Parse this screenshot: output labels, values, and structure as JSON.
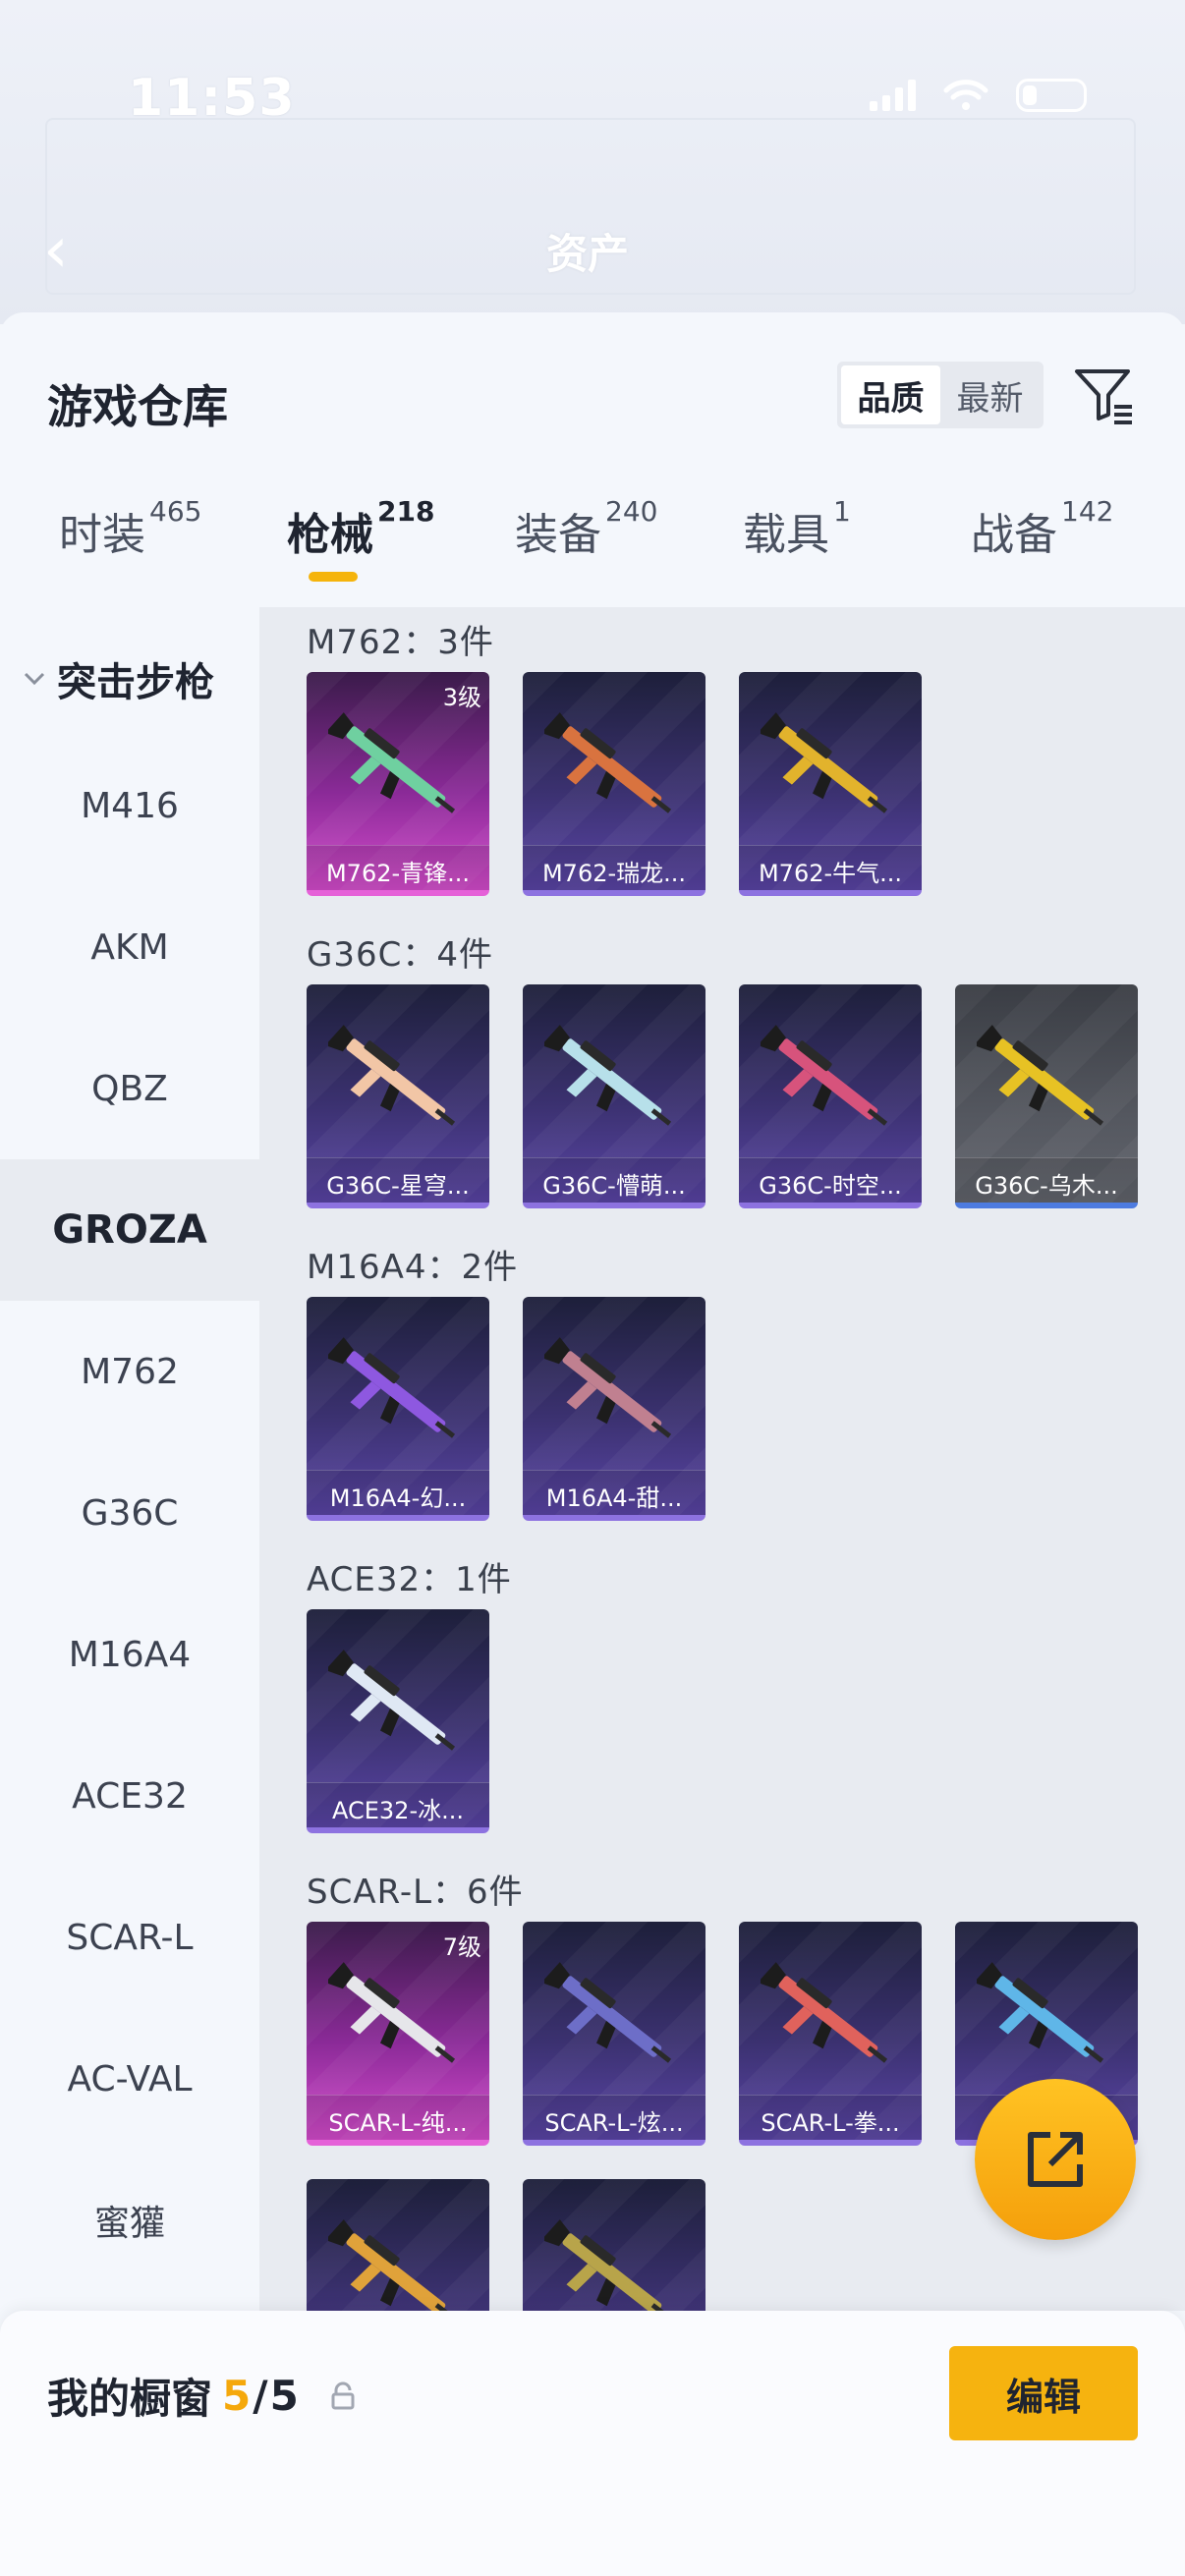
{
  "status": {
    "time": "11:53"
  },
  "header": {
    "title": "资产"
  },
  "sheet": {
    "title": "游戏仓库",
    "sort_options": [
      "品质",
      "最新"
    ],
    "active_sort": "品质"
  },
  "tabs": [
    {
      "label": "时装",
      "count": "465"
    },
    {
      "label": "枪械",
      "count": "218"
    },
    {
      "label": "装备",
      "count": "240"
    },
    {
      "label": "载具",
      "count": "1"
    },
    {
      "label": "战备",
      "count": "142"
    }
  ],
  "side": {
    "category": "突击步枪",
    "items": [
      "M416",
      "AKM",
      "QBZ",
      "GROZA",
      "M762",
      "G36C",
      "M16A4",
      "ACE32",
      "SCAR-L",
      "AC-VAL",
      "蜜獾"
    ],
    "active": "GROZA"
  },
  "groups": [
    {
      "title": "M762：3件",
      "items": [
        {
          "label": "M762-青锋...",
          "level": "3级",
          "rarity": "pink",
          "color": "#6fd0a0"
        },
        {
          "label": "M762-瑞龙...",
          "rarity": "purple",
          "color": "#d9733f"
        },
        {
          "label": "M762-牛气...",
          "rarity": "purple",
          "color": "#e2b32c"
        }
      ]
    },
    {
      "title": "G36C：4件",
      "items": [
        {
          "label": "G36C-星穹...",
          "rarity": "purple",
          "color": "#f2c6a6"
        },
        {
          "label": "G36C-懵萌...",
          "rarity": "purple",
          "color": "#b7e0ea"
        },
        {
          "label": "G36C-时空...",
          "rarity": "purple",
          "color": "#d7537c"
        },
        {
          "label": "G36C-乌木...",
          "rarity": "gray",
          "color": "#e7c224"
        }
      ]
    },
    {
      "title": "M16A4：2件",
      "items": [
        {
          "label": "M16A4-幻...",
          "rarity": "purple",
          "color": "#8e58e0"
        },
        {
          "label": "M16A4-甜...",
          "rarity": "purple",
          "color": "#c08090"
        }
      ]
    },
    {
      "title": "ACE32：1件",
      "items": [
        {
          "label": "ACE32-冰...",
          "rarity": "purple",
          "color": "#dfe8f4"
        }
      ]
    },
    {
      "title": "SCAR-L：6件",
      "items": [
        {
          "label": "SCAR-L-纯...",
          "level": "7级",
          "rarity": "pink",
          "color": "#e6e6ea"
        },
        {
          "label": "SCAR-L-炫...",
          "rarity": "purple",
          "color": "#6d6ec8"
        },
        {
          "label": "SCAR-L-拳...",
          "rarity": "purple",
          "color": "#e0625c"
        },
        {
          "label": "S",
          "rarity": "purple",
          "color": "#5fb6e8"
        },
        {
          "label": "",
          "rarity": "purple",
          "color": "#e0a23a"
        },
        {
          "label": "",
          "rarity": "purple",
          "color": "#b8a44a"
        }
      ]
    }
  ],
  "bottom": {
    "showcase_label": "我的橱窗",
    "count_current": "5",
    "count_slash": "/",
    "count_total": "5",
    "edit_label": "编辑"
  },
  "colors": {
    "accent": "#f6b30f",
    "purple_card": "#5a45a6",
    "pink_card": "#d54ccd"
  }
}
